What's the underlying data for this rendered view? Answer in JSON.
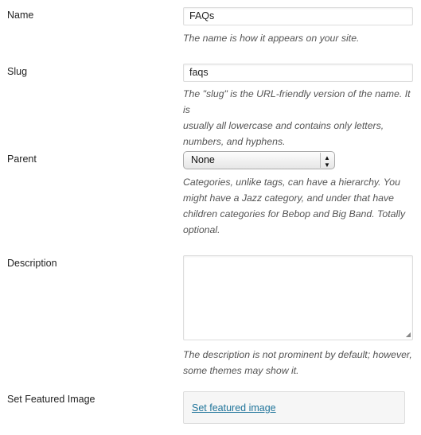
{
  "fields": {
    "name": {
      "label": "Name",
      "value": "FAQs",
      "description": "The name is how it appears on your site."
    },
    "slug": {
      "label": "Slug",
      "value": "faqs",
      "description_lines": [
        "The \"slug\" is the URL-friendly version of the name. It is",
        "usually all lowercase and contains only letters,",
        "numbers, and hyphens."
      ]
    },
    "parent": {
      "label": "Parent",
      "selected": "None",
      "description_lines": [
        "Categories, unlike tags, can have a hierarchy. You",
        "might have a Jazz category, and under that have",
        "children categories for Bebop and Big Band. Totally",
        "optional."
      ]
    },
    "description": {
      "label": "Description",
      "value": "",
      "description_lines": [
        "The description is not prominent by default; however,",
        "some themes may show it."
      ]
    },
    "featured_image": {
      "label": "Set Featured Image",
      "link": "Set featured image"
    }
  },
  "colors": {
    "link": "#21759b",
    "help_text": "#555555"
  }
}
